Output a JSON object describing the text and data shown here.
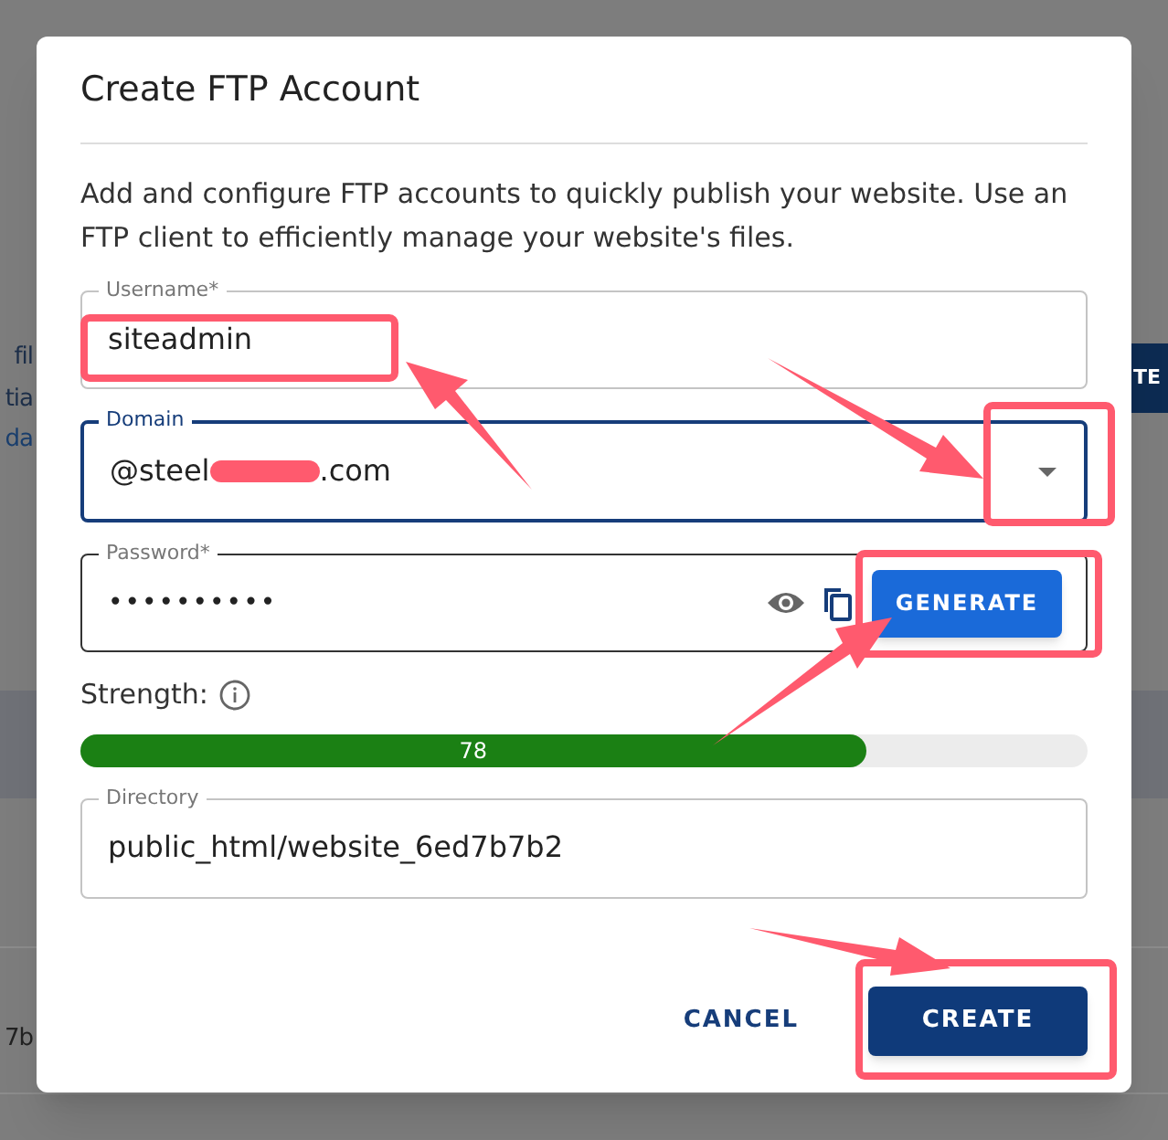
{
  "background": {
    "fragments": [
      {
        "text": "fil"
      },
      {
        "text": "tia"
      },
      {
        "text": "da"
      },
      {
        "text": "7b"
      }
    ],
    "button": {
      "label": "TE"
    }
  },
  "dialog": {
    "title": "Create FTP Account",
    "description": "Add and configure FTP accounts to quickly publish your website. Use an FTP client to efficiently manage your website's files.",
    "username": {
      "label": "Username*",
      "value": "siteadmin",
      "focused": false
    },
    "domain": {
      "label": "Domain",
      "value": "@steel",
      "suffix": ".com",
      "focused": true
    },
    "password": {
      "label": "Password*",
      "value": "••••••••••",
      "focused": false,
      "generate_button": "GENERATE"
    },
    "strength": {
      "label": "Strength:",
      "level": 0.78,
      "reading": "78"
    },
    "directory": {
      "label": "Directory",
      "value": "public_html/website_6ed7b7b2",
      "focused": false
    },
    "buttons": [
      {
        "label": "CANCEL",
        "kind": "text"
      },
      {
        "label": "CREATE",
        "kind": "primary"
      }
    ]
  }
}
